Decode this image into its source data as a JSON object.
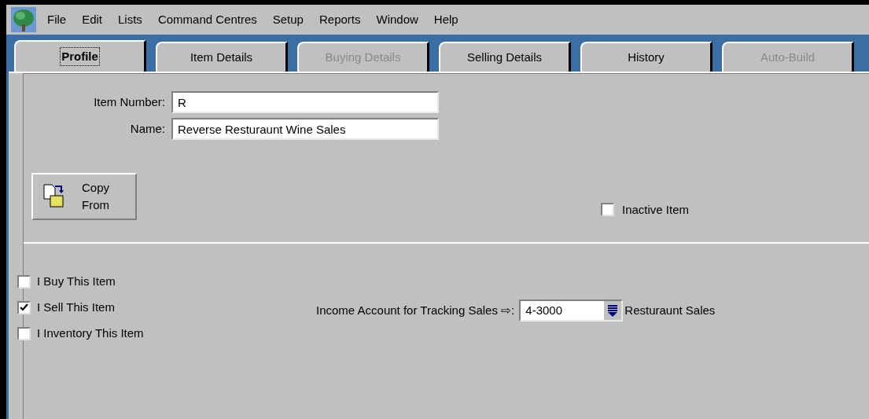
{
  "menu_bar": [
    "File",
    "Edit",
    "Lists",
    "Command Centres",
    "Setup",
    "Reports",
    "Window",
    "Help"
  ],
  "tabs": [
    {
      "label": "Profile",
      "selected": true,
      "disabled": false
    },
    {
      "label": "Item Details",
      "selected": false,
      "disabled": false
    },
    {
      "label": "Buying Details",
      "selected": false,
      "disabled": true
    },
    {
      "label": "Selling Details",
      "selected": false,
      "disabled": false
    },
    {
      "label": "History",
      "selected": false,
      "disabled": false
    },
    {
      "label": "Auto-Build",
      "selected": false,
      "disabled": true
    }
  ],
  "fields": [
    {
      "label": "Item Number:",
      "value": "R"
    },
    {
      "label": "Name:",
      "value": "Reverse Resturaunt Wine Sales"
    }
  ],
  "copy_from_button": {
    "label": "Copy From"
  },
  "inactive_item": {
    "label": "Inactive Item",
    "checked": false
  },
  "options": [
    {
      "label": "I Buy This Item",
      "checked": false
    },
    {
      "label": "I Sell This Item",
      "checked": true
    },
    {
      "label": "I Inventory This Item",
      "checked": false
    }
  ],
  "income_account": {
    "label": "Income Account for Tracking Sales ⇨:",
    "value": "4-3000",
    "account_name": "Resturaunt Sales"
  }
}
